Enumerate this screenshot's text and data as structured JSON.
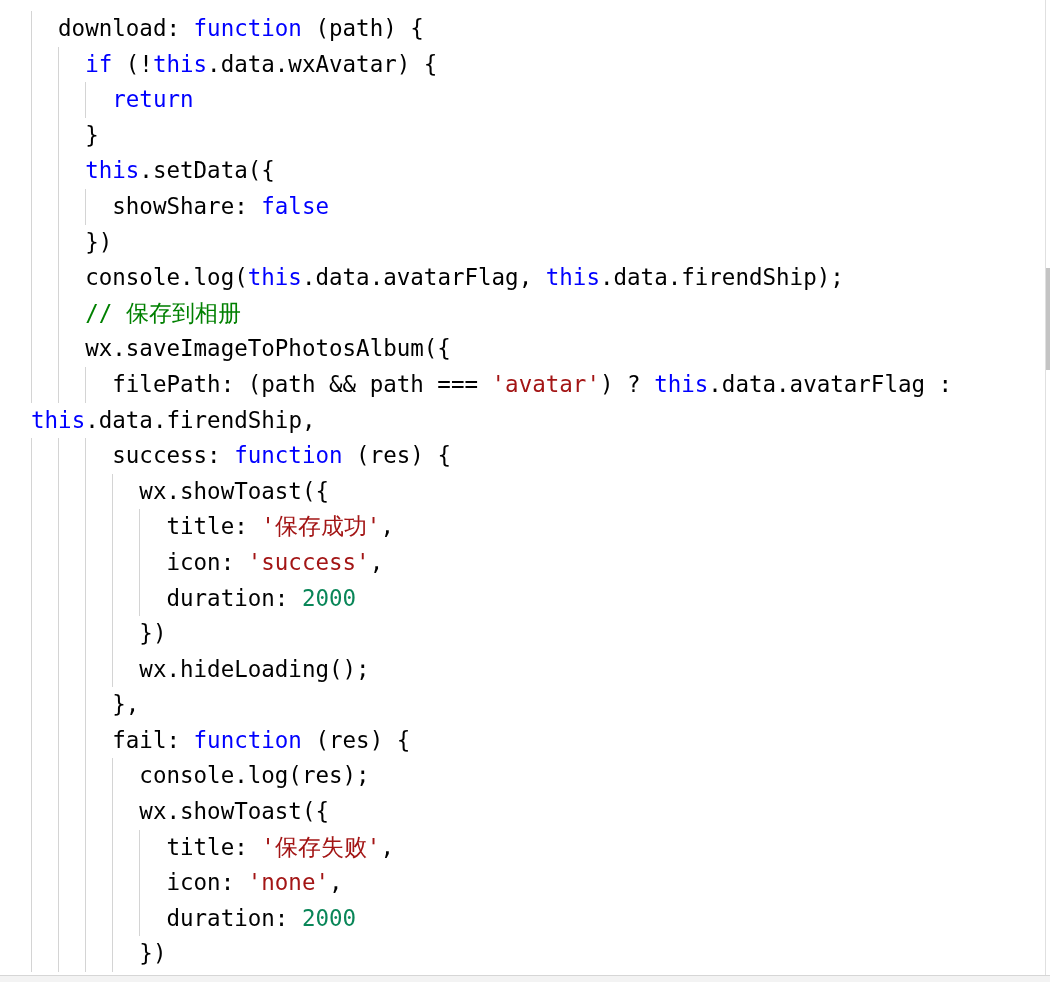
{
  "code_lines": [
    {
      "tokens": [
        {
          "t": "download: ",
          "kind": "plain"
        },
        {
          "t": "function",
          "kind": "keyword"
        },
        {
          "t": " (path) {",
          "kind": "plain"
        }
      ],
      "children": [
        {
          "tokens": [
            {
              "t": "if",
              "kind": "keyword"
            },
            {
              "t": " (!",
              "kind": "plain"
            },
            {
              "t": "this",
              "kind": "keyword"
            },
            {
              "t": ".data.wxAvatar) {",
              "kind": "plain"
            }
          ],
          "children": [
            {
              "tokens": [
                {
                  "t": "return",
                  "kind": "keyword"
                }
              ]
            }
          ]
        },
        {
          "tokens": [
            {
              "t": "}",
              "kind": "plain"
            }
          ]
        },
        {
          "tokens": [
            {
              "t": "this",
              "kind": "keyword"
            },
            {
              "t": ".setData({",
              "kind": "plain"
            }
          ],
          "children": [
            {
              "tokens": [
                {
                  "t": "showShare: ",
                  "kind": "plain"
                },
                {
                  "t": "false",
                  "kind": "keyword"
                }
              ]
            }
          ]
        },
        {
          "tokens": [
            {
              "t": "})",
              "kind": "plain"
            }
          ]
        },
        {
          "tokens": [
            {
              "t": "console.log(",
              "kind": "plain"
            },
            {
              "t": "this",
              "kind": "keyword"
            },
            {
              "t": ".data.avatarFlag, ",
              "kind": "plain"
            },
            {
              "t": "this",
              "kind": "keyword"
            },
            {
              "t": ".data.firendShip);",
              "kind": "plain"
            }
          ]
        },
        {
          "tokens": [
            {
              "t": "// 保存到相册",
              "kind": "comment"
            }
          ]
        },
        {
          "tokens": [
            {
              "t": "wx.saveImageToPhotosAlbum({",
              "kind": "plain"
            }
          ],
          "children": [
            {
              "tokens": [
                {
                  "t": "filePath: (path && path === ",
                  "kind": "plain"
                },
                {
                  "t": "'avatar'",
                  "kind": "string"
                },
                {
                  "t": ") ? ",
                  "kind": "plain"
                },
                {
                  "t": "this",
                  "kind": "keyword"
                },
                {
                  "t": ".data.avatarFlag : ",
                  "kind": "plain"
                },
                {
                  "t": "this",
                  "kind": "keyword"
                },
                {
                  "t": ".data.firendShip,",
                  "kind": "plain"
                }
              ]
            },
            {
              "tokens": [
                {
                  "t": "success: ",
                  "kind": "plain"
                },
                {
                  "t": "function",
                  "kind": "keyword"
                },
                {
                  "t": " (res) {",
                  "kind": "plain"
                }
              ],
              "children": [
                {
                  "tokens": [
                    {
                      "t": "wx.showToast({",
                      "kind": "plain"
                    }
                  ],
                  "children": [
                    {
                      "tokens": [
                        {
                          "t": "title: ",
                          "kind": "plain"
                        },
                        {
                          "t": "'保存成功'",
                          "kind": "string"
                        },
                        {
                          "t": ",",
                          "kind": "plain"
                        }
                      ]
                    },
                    {
                      "tokens": [
                        {
                          "t": "icon: ",
                          "kind": "plain"
                        },
                        {
                          "t": "'success'",
                          "kind": "string"
                        },
                        {
                          "t": ",",
                          "kind": "plain"
                        }
                      ]
                    },
                    {
                      "tokens": [
                        {
                          "t": "duration: ",
                          "kind": "plain"
                        },
                        {
                          "t": "2000",
                          "kind": "number"
                        }
                      ]
                    }
                  ]
                },
                {
                  "tokens": [
                    {
                      "t": "})",
                      "kind": "plain"
                    }
                  ]
                },
                {
                  "tokens": [
                    {
                      "t": "wx.hideLoading();",
                      "kind": "plain"
                    }
                  ]
                }
              ]
            },
            {
              "tokens": [
                {
                  "t": "},",
                  "kind": "plain"
                }
              ]
            },
            {
              "tokens": [
                {
                  "t": "fail: ",
                  "kind": "plain"
                },
                {
                  "t": "function",
                  "kind": "keyword"
                },
                {
                  "t": " (res) {",
                  "kind": "plain"
                }
              ],
              "children": [
                {
                  "tokens": [
                    {
                      "t": "console.log(res);",
                      "kind": "plain"
                    }
                  ]
                },
                {
                  "tokens": [
                    {
                      "t": "wx.showToast({",
                      "kind": "plain"
                    }
                  ],
                  "children": [
                    {
                      "tokens": [
                        {
                          "t": "title: ",
                          "kind": "plain"
                        },
                        {
                          "t": "'保存失败'",
                          "kind": "string"
                        },
                        {
                          "t": ",",
                          "kind": "plain"
                        }
                      ]
                    },
                    {
                      "tokens": [
                        {
                          "t": "icon: ",
                          "kind": "plain"
                        },
                        {
                          "t": "'none'",
                          "kind": "string"
                        },
                        {
                          "t": ",",
                          "kind": "plain"
                        }
                      ]
                    },
                    {
                      "tokens": [
                        {
                          "t": "duration: ",
                          "kind": "plain"
                        },
                        {
                          "t": "2000",
                          "kind": "number"
                        }
                      ]
                    }
                  ]
                },
                {
                  "tokens": [
                    {
                      "t": "})",
                      "kind": "plain"
                    }
                  ]
                }
              ]
            }
          ]
        }
      ]
    }
  ]
}
